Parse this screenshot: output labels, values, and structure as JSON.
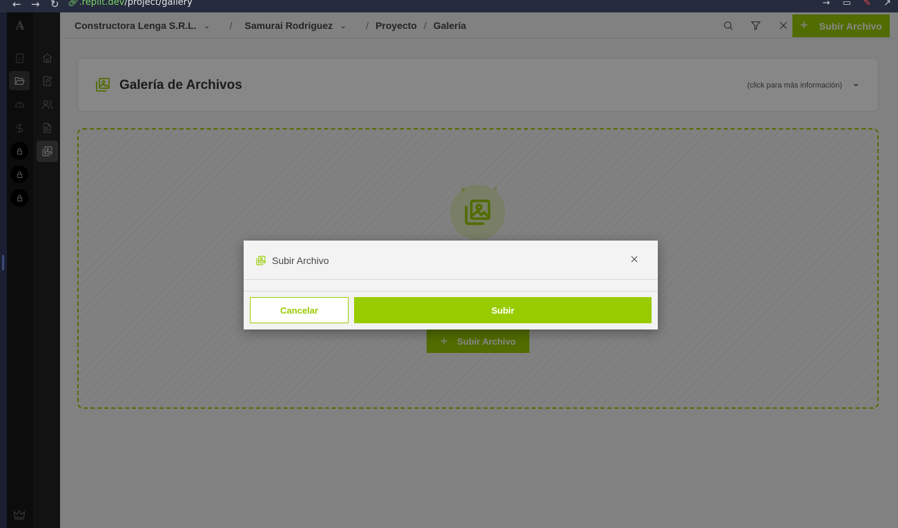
{
  "browser": {
    "url_host": ".replit.dev",
    "url_path": "/project/gallery"
  },
  "rail": {
    "logo": "A"
  },
  "breadcrumb": {
    "company": "Constructora Lenga S.R.L.",
    "user": "Samurai Rodriguez",
    "section": "Proyecto",
    "page": "Galería",
    "separator": "/"
  },
  "toolbar": {
    "upload_label": "Subir Archivo"
  },
  "header": {
    "title": "Galería de Archivos",
    "info": "(click para más información)"
  },
  "dropzone": {
    "button_label": "Subir Archivo"
  },
  "modal": {
    "title": "Subir Archivo",
    "cancel_label": "Cancelar",
    "submit_label": "Subir"
  },
  "colors": {
    "accent": "#99cc00",
    "overlay": "rgba(0,0,0,0.47)"
  }
}
